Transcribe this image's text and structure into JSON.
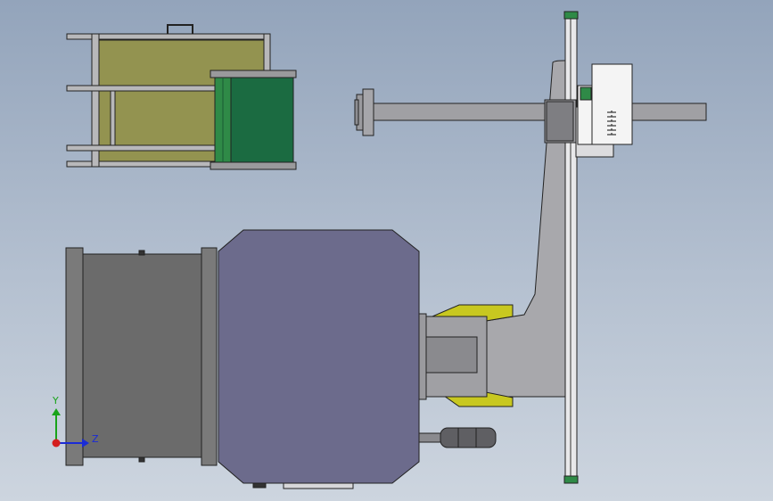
{
  "viewport": {
    "background_top": "#93a4bb",
    "background_bottom": "#cdd5df"
  },
  "triad": {
    "y_label": "Y",
    "z_label": "Z",
    "y_color": "#19a31a",
    "z_color": "#1a2bd6",
    "origin_color": "#d41e1e"
  },
  "colors": {
    "frame_olive": "#939350",
    "belt_green": "#1b6b41",
    "roller_green": "#2f8a47",
    "casing_gray": "#6b6b6b",
    "motor_blue": "#6c6b8c",
    "column_gray": "#a8a8ac",
    "yellow_flange": "#c8c820",
    "cabinet_white": "#f4f4f4"
  }
}
